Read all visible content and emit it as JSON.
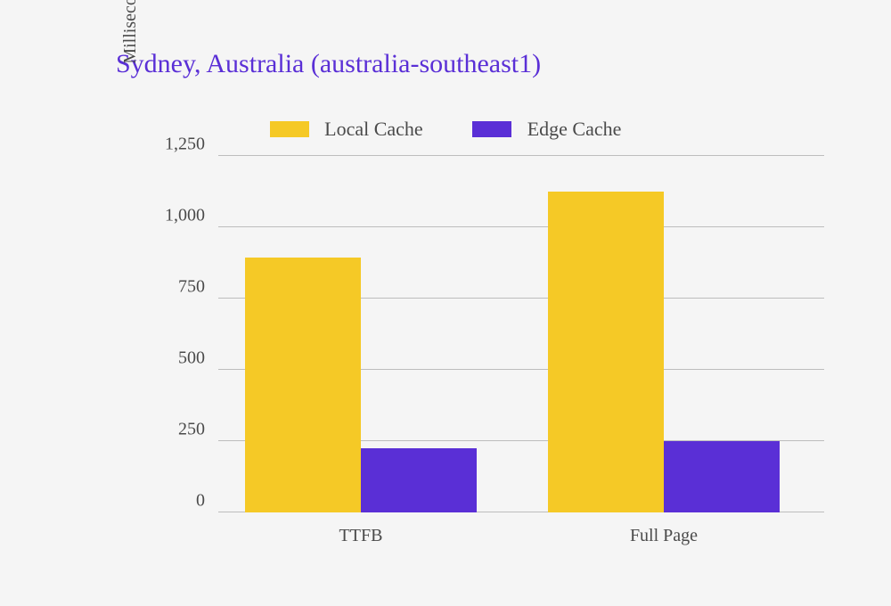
{
  "chart_data": {
    "type": "bar",
    "title": "Sydney, Australia (australia-southeast1)",
    "xlabel": "",
    "ylabel": "Milliseconds",
    "ylim": [
      0,
      1250
    ],
    "yticks": [
      0,
      250,
      500,
      750,
      1000,
      1250
    ],
    "ytick_labels": [
      "0",
      "250",
      "500",
      "750",
      "1,000",
      "1,250"
    ],
    "categories": [
      "TTFB",
      "Full Page"
    ],
    "series": [
      {
        "name": "Local Cache",
        "color": "#f5c926",
        "values": [
          895,
          1125
        ]
      },
      {
        "name": "Edge Cache",
        "color": "#5a2fd6",
        "values": [
          225,
          250
        ]
      }
    ],
    "legend_position": "top",
    "grid": true
  }
}
